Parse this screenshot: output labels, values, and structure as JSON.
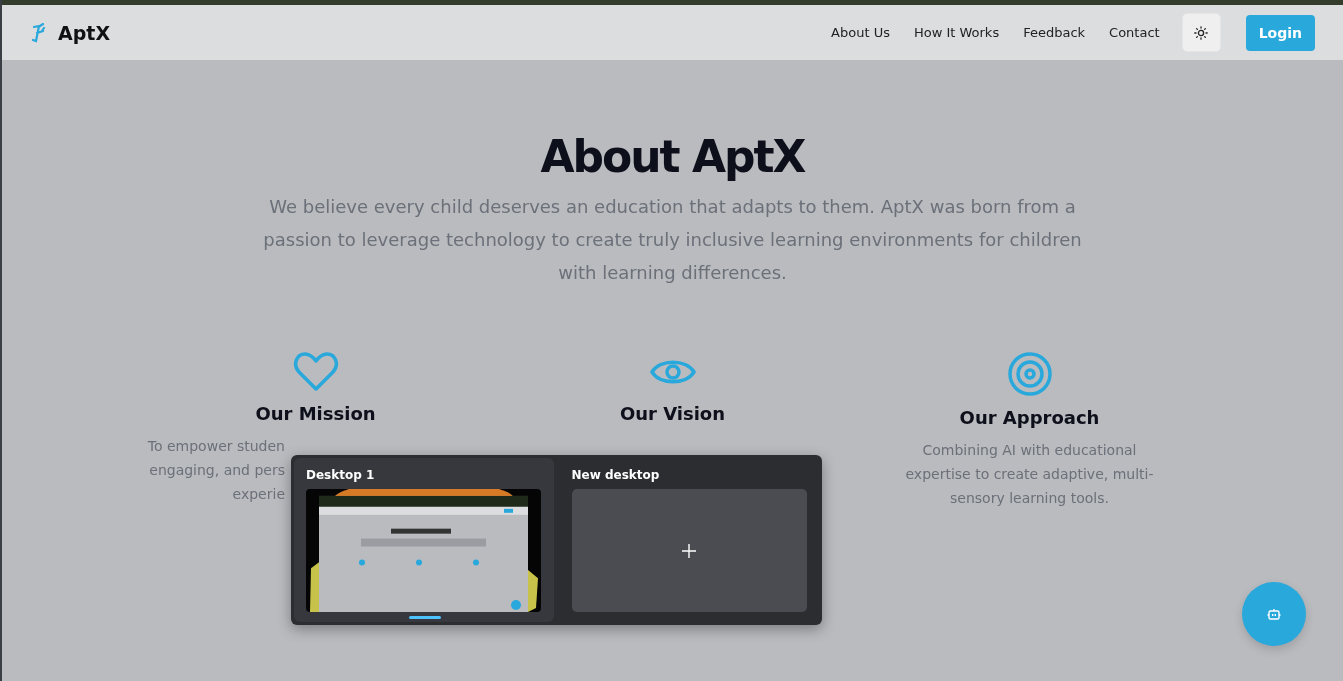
{
  "nav": {
    "brand": "AptX",
    "links": [
      {
        "label": "About Us"
      },
      {
        "label": "How It Works"
      },
      {
        "label": "Feedback"
      },
      {
        "label": "Contact"
      }
    ],
    "login": "Login"
  },
  "hero": {
    "title": "About AptX",
    "text": "We believe every child deserves an education that adapts to them. AptX was born from a passion to leverage technology to create truly inclusive learning environments for children with learning differences."
  },
  "features": [
    {
      "title": "Our Mission",
      "lines": [
        "To empower studen",
        "engaging, and pers",
        "experie"
      ]
    },
    {
      "title": "Our Vision"
    },
    {
      "title": "Our Approach",
      "lines": [
        "Combining AI with educational",
        "expertise to create adaptive, multi-",
        "sensory learning tools."
      ]
    }
  ],
  "task_view": {
    "desktops": [
      {
        "label": "Desktop 1",
        "kind": "picture",
        "selected": true
      },
      {
        "label": "New desktop",
        "kind": "new",
        "selected": false
      }
    ]
  }
}
